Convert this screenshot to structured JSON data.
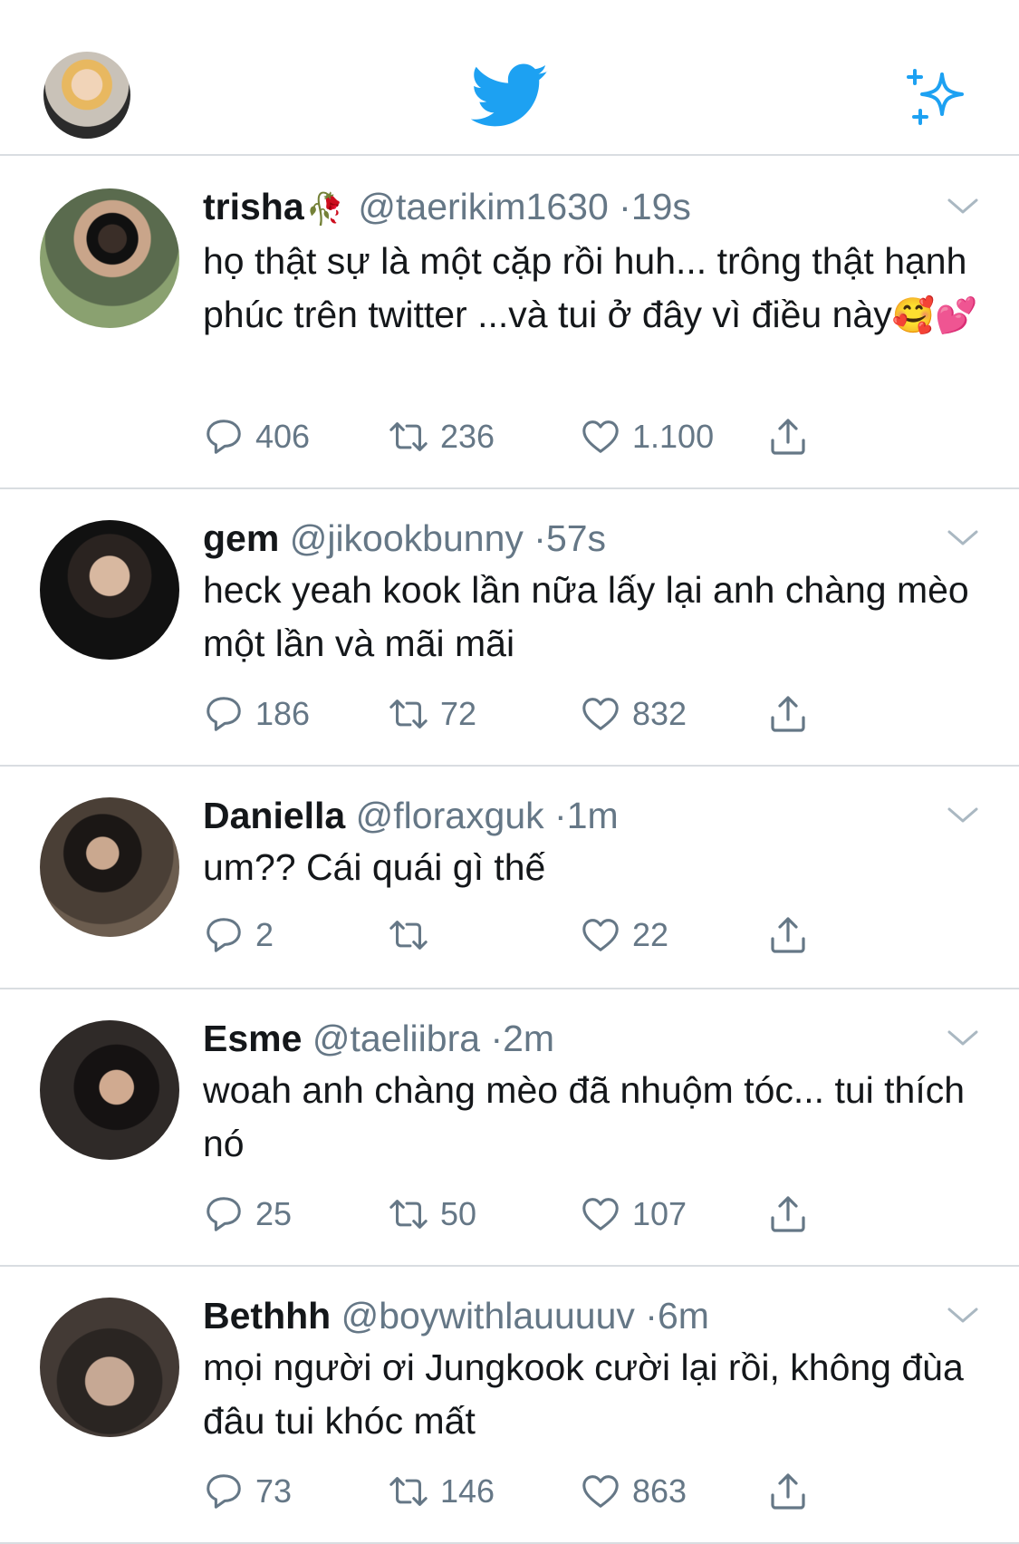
{
  "header": {
    "profile_avatar": "profile-avatar",
    "logo_icon": "twitter-bird-icon",
    "action_icon": "sparkle-icon",
    "brand_color": "#1da1f2"
  },
  "tweets": [
    {
      "name": "trisha",
      "name_emoji": "🥀",
      "handle": "@taerikim1630",
      "time": "19s",
      "text": "họ thật sự là một cặp rồi huh... trông thật hạnh phúc trên twitter ...và tui ở đây vì điều này",
      "text_emoji": "🥰💕",
      "replies": "406",
      "retweets": "236",
      "likes": "1.100"
    },
    {
      "name": "gem",
      "handle": "@jikookbunny",
      "time": "57s",
      "text": "heck yeah kook lần nữa lấy lại anh chàng mèo một lần và mãi mãi",
      "replies": "186",
      "retweets": "72",
      "likes": "832"
    },
    {
      "name": "Daniella",
      "handle": "@floraxguk",
      "time": "1m",
      "text": "um?? Cái quái gì thế",
      "replies": "2",
      "retweets": "",
      "likes": "22"
    },
    {
      "name": "Esme",
      "handle": "@taeliibra",
      "time": "2m",
      "text": "woah anh chàng mèo đã nhuộm tóc... tui thích nó",
      "replies": "25",
      "retweets": "50",
      "likes": "107"
    },
    {
      "name": "Bethhh",
      "handle": "@boywithlauuuuv",
      "time": "6m",
      "text": "mọi người ơi Jungkook cười lại rồi, không đùa đâu tui khóc mất",
      "replies": "73",
      "retweets": "146",
      "likes": "863"
    }
  ],
  "separator": "·",
  "icons": {
    "reply": "reply-icon",
    "retweet": "retweet-icon",
    "like": "heart-icon",
    "share": "share-icon",
    "more": "chevron-down-icon"
  },
  "colors": {
    "text_primary": "#14171a",
    "text_secondary": "#657786",
    "divider": "#d9dde1"
  }
}
